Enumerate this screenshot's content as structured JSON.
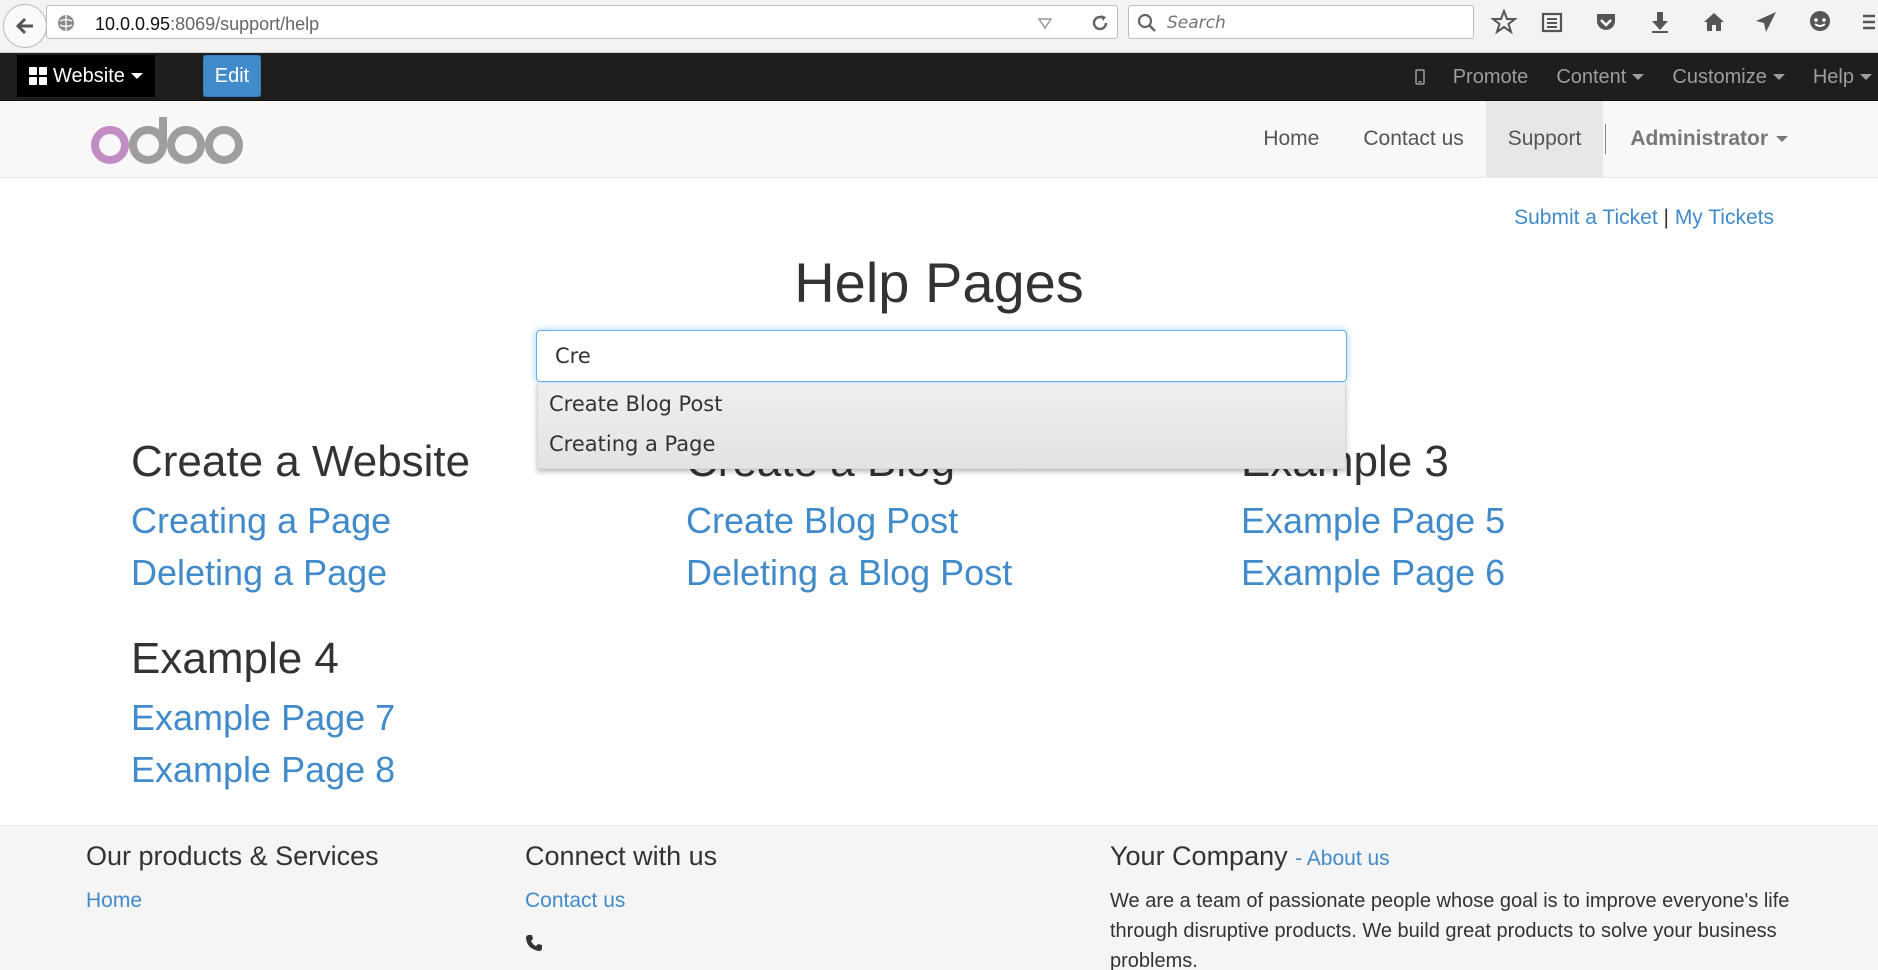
{
  "browser": {
    "url_host": "10.0.0.95",
    "url_rest": ":8069/support/help",
    "search_placeholder": "Search"
  },
  "admin_bar": {
    "website_label": "Website",
    "edit_label": "Edit",
    "promote_label": "Promote",
    "content_label": "Content",
    "customize_label": "Customize",
    "help_label": "Help"
  },
  "site_nav": {
    "home": "Home",
    "contact": "Contact us",
    "support": "Support",
    "admin": "Administrator"
  },
  "page": {
    "submit_ticket": "Submit a Ticket",
    "separator": "|",
    "my_tickets": "My Tickets",
    "title": "Help Pages",
    "search_value": "Cre",
    "suggestions": [
      "Create Blog Post",
      "Creating a Page"
    ]
  },
  "categories": [
    {
      "title": "Create a Website",
      "links": [
        "Creating a Page",
        "Deleting a Page"
      ]
    },
    {
      "title": "Create a Blog",
      "links": [
        "Create Blog Post",
        "Deleting a Blog Post"
      ]
    },
    {
      "title": "Example 3",
      "links": [
        "Example Page 5",
        "Example Page 6"
      ]
    },
    {
      "title": "Example 4",
      "links": [
        "Example Page 7",
        "Example Page 8"
      ]
    }
  ],
  "footer": {
    "products_title": "Our products & Services",
    "products_home": "Home",
    "connect_title": "Connect with us",
    "connect_contact": "Contact us",
    "company_title": "Your Company",
    "about_link": "- About us",
    "company_text": "We are a team of passionate people whose goal is to improve everyone's life through disruptive products. We build great products to solve your business problems."
  },
  "colors": {
    "link": "#428bca",
    "admin_bar": "#1e1e1e",
    "edit_button": "#428bca",
    "logo_o": "#c28cc4",
    "logo_gray": "#9e9e9e"
  }
}
